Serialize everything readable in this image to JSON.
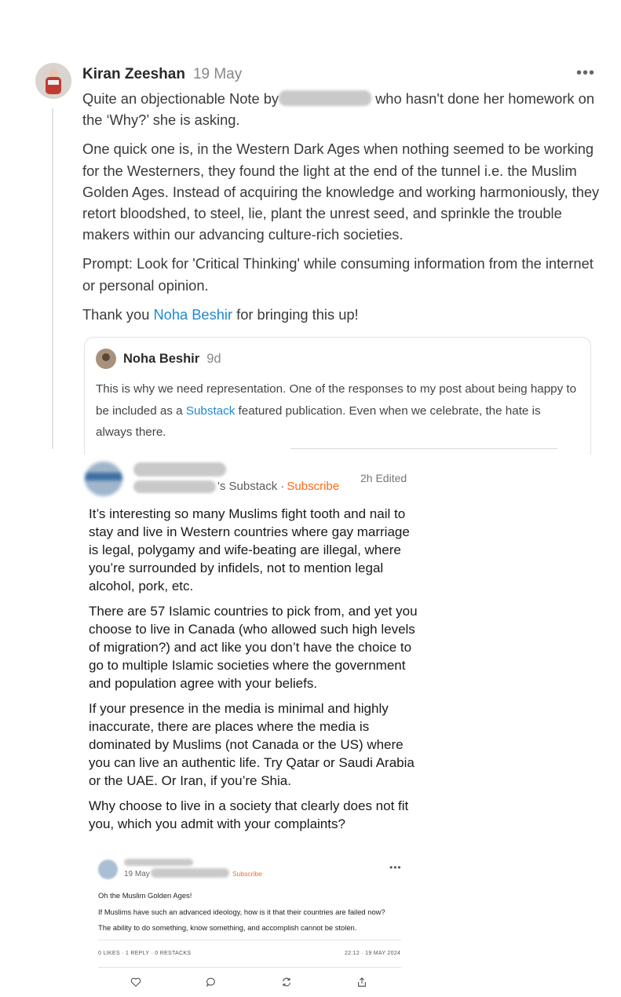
{
  "note": {
    "author": "Kiran Zeeshan",
    "date": "19 May",
    "para1_before": "Quite an objectionable Note by",
    "para1_after": " who hasn't done her homework on the ‘Why?’ she is asking.",
    "para2": "One quick one is, in the Western Dark Ages when nothing seemed to be working for the Westerners, they found the light at the end of the tunnel i.e. the Muslim Golden Ages. Instead of acquiring the knowledge and working harmoniously, they retort bloodshed, to steel, lie, plant the unrest seed, and sprinkle the trouble makers within our advancing culture-rich societies.",
    "para3": "Prompt: Look for 'Critical Thinking' while consuming information from the internet or personal opinion.",
    "para4_before": "Thank you ",
    "para4_link": "Noha Beshir",
    "para4_after": " for bringing this up!"
  },
  "embed": {
    "author": "Noha Beshir",
    "date": "9d",
    "text_before": "This is why we need representation. One of the responses to my post about being happy to be included as a ",
    "text_link": "Substack",
    "text_after": " featured publication. Even when we celebrate, the hate is always there."
  },
  "reply": {
    "pub_suffix": "'s Substack ·",
    "subscribe": "Subscribe",
    "time": "2h  Edited",
    "paragraphs": [
      "It’s interesting so many Muslims fight tooth and nail to stay and live in Western countries where gay marriage is legal, polygamy and wife-beating are illegal, where you’re surrounded by infidels, not to mention legal alcohol, pork, etc.",
      "There are 57 Islamic countries to pick from, and yet you choose to live in Canada (who allowed such high levels of migration?) and act like you don’t have the choice to go to multiple Islamic societies where the government and population agree with your beliefs.",
      "If your presence in the media is minimal and highly inaccurate, there are places where the media is dominated by Muslims (not Canada or the US) where you can live an authentic life. Try Qatar or Saudi Arabia or the UAE. Or Iran, if you’re Shia.",
      "Why choose to live in a society that clearly does not fit you, which you admit with your complaints?"
    ]
  },
  "quoted": {
    "date": "19 May",
    "subscribe": "Subscribe",
    "lines": [
      "Oh the Muslim Golden Ages!",
      "If Muslims have such an advanced ideology, how is it that their countries are failed now?",
      "The ability to do something, know something, and accomplish cannot be stolen."
    ],
    "stats": "0 LIKES · 1 REPLY · 0 RESTACKS",
    "timestamp": "22:12 · 19 MAY 2024"
  },
  "colors": {
    "link": "#1e88d1",
    "subscribe": "#ff6719"
  }
}
